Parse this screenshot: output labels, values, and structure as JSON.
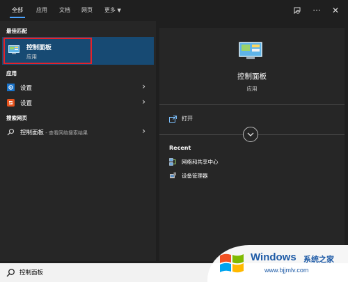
{
  "tabs": [
    {
      "label": "全部"
    },
    {
      "label": "应用"
    },
    {
      "label": "文档"
    },
    {
      "label": "网页"
    },
    {
      "label": "更多"
    }
  ],
  "toolbar": {
    "feedback_icon": "feedback-icon",
    "more_icon": "more-icon",
    "close_icon": "close-icon"
  },
  "sections": {
    "best_match": "最佳匹配",
    "apps": "应用",
    "web": "搜索网页"
  },
  "best_match": {
    "title": "控制面板",
    "subtitle": "应用"
  },
  "apps": [
    {
      "label": "设置",
      "icon": "settings-icon"
    },
    {
      "label": "设置",
      "icon": "app-icon"
    }
  ],
  "web": {
    "label": "控制面板",
    "suffix": " - 查看网络搜索结果"
  },
  "detail": {
    "title": "控制面板",
    "subtitle": "应用",
    "open_label": "打开",
    "recent_heading": "Recent",
    "recent": [
      {
        "label": "网络和共享中心"
      },
      {
        "label": "设备管理器"
      }
    ]
  },
  "search": {
    "value": "控制面板"
  },
  "watermark": {
    "title": "Windows",
    "cn": "系统之家",
    "url": "www.bjjmlv.com"
  },
  "colors": {
    "accent": "#4aa3ff",
    "selected": "#174a73",
    "highlight_border": "#e5222a",
    "watermark": "#1d5aa6"
  }
}
